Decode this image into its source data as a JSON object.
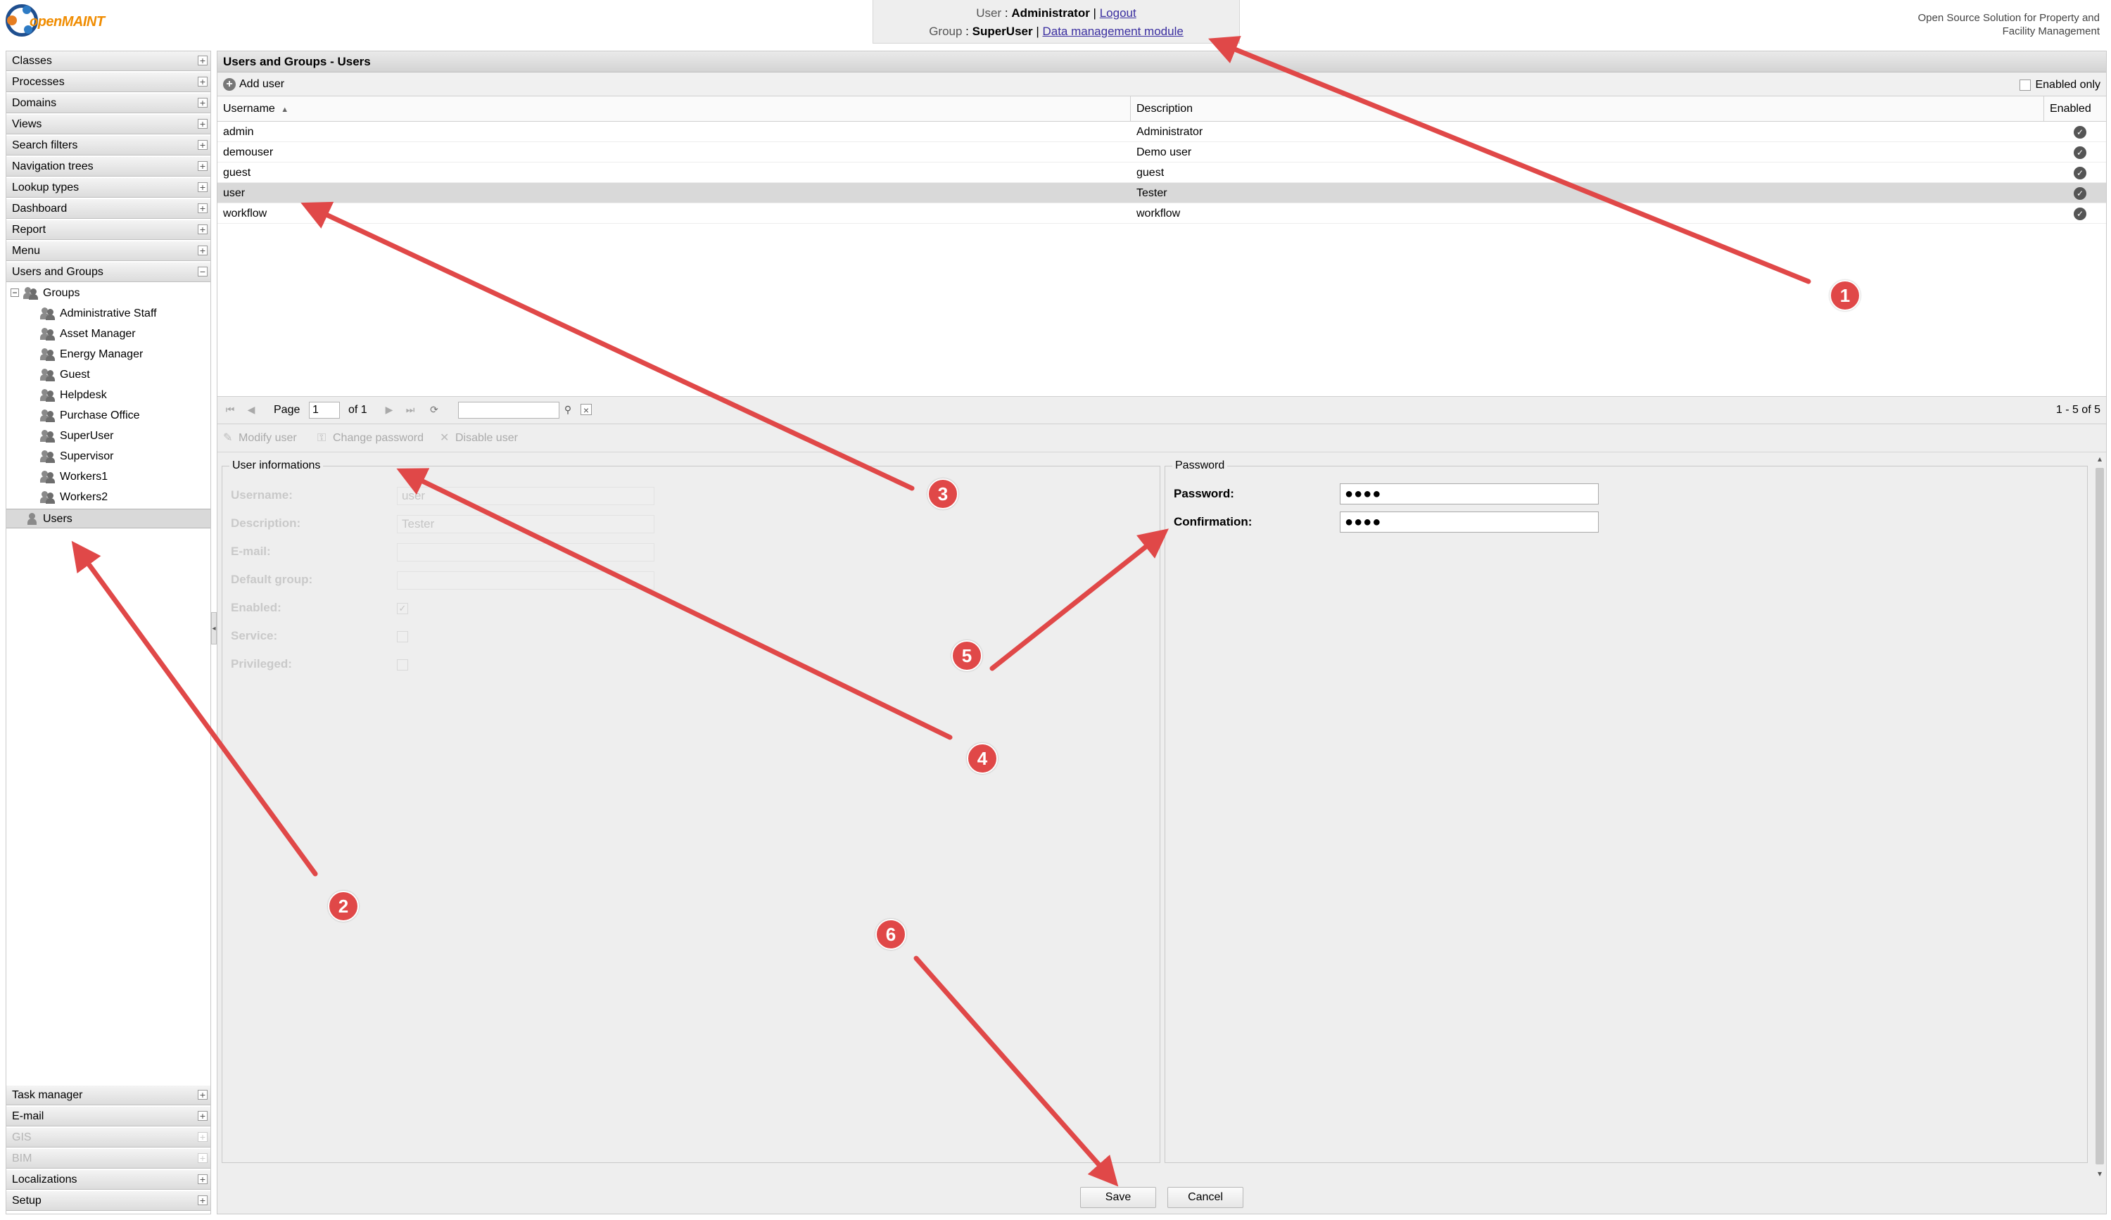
{
  "header": {
    "logo_text": "openMAINT",
    "user_label": "User",
    "user_name": "Administrator",
    "logout": "Logout",
    "group_label": "Group",
    "group_name": "SuperUser",
    "data_module": "Data management module",
    "tagline_line1": "Open Source Solution for Property and",
    "tagline_line2": "Facility Management"
  },
  "sidebar": {
    "top_items": [
      {
        "label": "Classes",
        "toggle": "+"
      },
      {
        "label": "Processes",
        "toggle": "+"
      },
      {
        "label": "Domains",
        "toggle": "+"
      },
      {
        "label": "Views",
        "toggle": "+"
      },
      {
        "label": "Search filters",
        "toggle": "+"
      },
      {
        "label": "Navigation trees",
        "toggle": "+"
      },
      {
        "label": "Lookup types",
        "toggle": "+"
      },
      {
        "label": "Dashboard",
        "toggle": "+"
      },
      {
        "label": "Report",
        "toggle": "+"
      },
      {
        "label": "Menu",
        "toggle": "+"
      },
      {
        "label": "Users and Groups",
        "toggle": "−"
      }
    ],
    "tree": {
      "root_toggle": "−",
      "groups_label": "Groups",
      "groups": [
        "Administrative Staff",
        "Asset Manager",
        "Energy Manager",
        "Guest",
        "Helpdesk",
        "Purchase Office",
        "SuperUser",
        "Supervisor",
        "Workers1",
        "Workers2"
      ],
      "users_label": "Users"
    },
    "bottom_items": [
      {
        "label": "Task manager",
        "toggle": "+"
      },
      {
        "label": "E-mail",
        "toggle": "+"
      },
      {
        "label": "GIS",
        "toggle": "+"
      },
      {
        "label": "BIM",
        "toggle": "+"
      },
      {
        "label": "Localizations",
        "toggle": "+"
      },
      {
        "label": "Setup",
        "toggle": "+"
      }
    ]
  },
  "main": {
    "title": "Users and Groups - Users",
    "add_user": "Add user",
    "enabled_only": "Enabled only",
    "columns": [
      "Username",
      "Description",
      "Enabled"
    ],
    "sort_indicator": "▲",
    "rows": [
      {
        "username": "admin",
        "description": "Administrator",
        "enabled": "✓"
      },
      {
        "username": "demouser",
        "description": "Demo user",
        "enabled": "✓"
      },
      {
        "username": "guest",
        "description": "guest",
        "enabled": "✓"
      },
      {
        "username": "user",
        "description": "Tester",
        "enabled": "✓"
      },
      {
        "username": "workflow",
        "description": "workflow",
        "enabled": "✓"
      }
    ],
    "selected_row": 3,
    "pager": {
      "page_label": "Page",
      "page_value": "1",
      "of_label": "of 1",
      "status": "1 - 5 of 5"
    },
    "actions": {
      "modify": "Modify user",
      "change_password": "Change password",
      "disable": "Disable user"
    },
    "user_info": {
      "legend": "User informations",
      "fields": [
        {
          "label": "Username:",
          "value": "user"
        },
        {
          "label": "Description:",
          "value": "Tester"
        },
        {
          "label": "E-mail:",
          "value": ""
        },
        {
          "label": "Default group:",
          "value": ""
        }
      ],
      "checks": [
        {
          "label": "Enabled:",
          "checked": "✓"
        },
        {
          "label": "Service:",
          "checked": ""
        },
        {
          "label": "Privileged:",
          "checked": ""
        }
      ]
    },
    "password": {
      "legend": "Password",
      "password_label": "Password:",
      "password_value": "●●●●",
      "confirm_label": "Confirmation:",
      "confirm_value": "●●●●"
    },
    "save": "Save",
    "cancel": "Cancel"
  },
  "annotations": [
    "1",
    "2",
    "3",
    "4",
    "5",
    "6"
  ],
  "colors": {
    "accent_orange": "#f08c00",
    "annotation_red": "#e04848",
    "link_purple": "#3b2fa0"
  }
}
